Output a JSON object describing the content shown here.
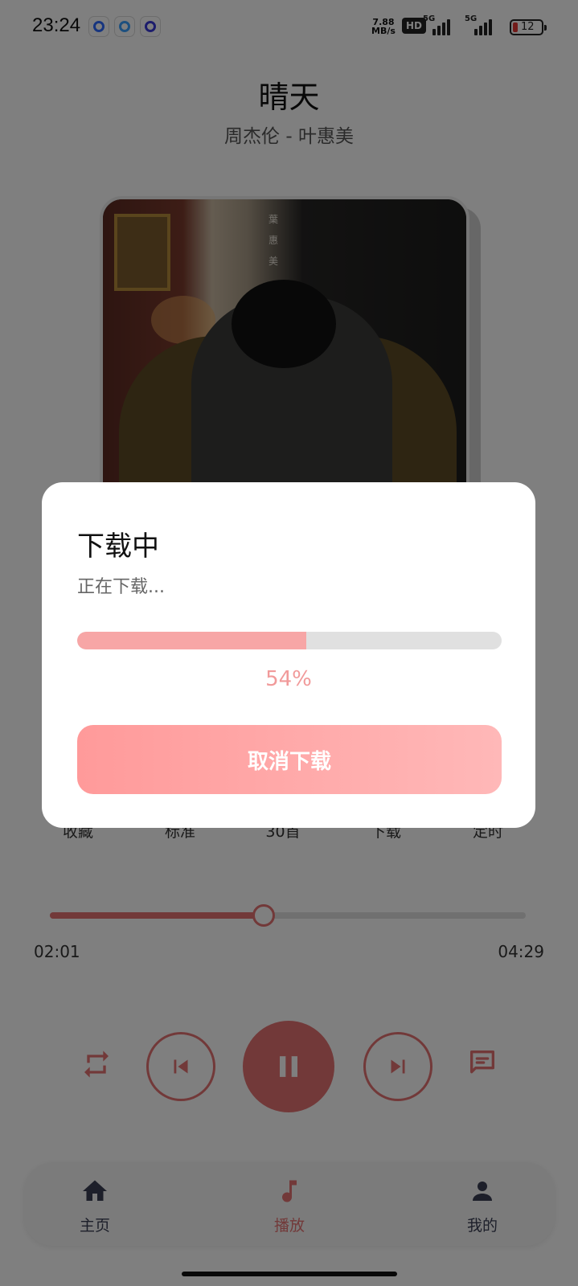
{
  "status_bar": {
    "time": "23:24",
    "net_speed_top": "7.88",
    "net_speed_unit": "MB/s",
    "hd_label": "HD",
    "sig1_label": "5G",
    "sig2_label": "5G",
    "battery_level": "12",
    "battery_color": "#e53935"
  },
  "song": {
    "title": "晴天",
    "artist": "周杰伦 - 叶惠美",
    "cover_text": "葉惠美"
  },
  "functions": [
    {
      "label": "收藏",
      "icon": "heart-icon"
    },
    {
      "label": "标准",
      "icon": "quality-icon"
    },
    {
      "label": "30首",
      "icon": "playlist-icon"
    },
    {
      "label": "下载",
      "icon": "download-icon"
    },
    {
      "label": "定时",
      "icon": "timer-icon"
    }
  ],
  "player": {
    "current_time": "02:01",
    "total_time": "04:29",
    "progress_fraction": 0.45,
    "accent_color": "#e57373"
  },
  "controls": {
    "loop_icon": "repeat-icon",
    "prev_icon": "skip-previous-icon",
    "play_icon": "pause-icon",
    "next_icon": "skip-next-icon",
    "comment_icon": "comment-icon"
  },
  "bottom_nav": [
    {
      "label": "主页",
      "icon": "home-icon",
      "active": false
    },
    {
      "label": "播放",
      "icon": "music-note-icon",
      "active": true
    },
    {
      "label": "我的",
      "icon": "person-icon",
      "active": false
    }
  ],
  "dialog": {
    "title": "下载中",
    "message": "正在下载...",
    "progress_fraction": 0.54,
    "percent_text": "54%",
    "cancel_label": "取消下载",
    "accent_color": "#f7a6a6"
  }
}
